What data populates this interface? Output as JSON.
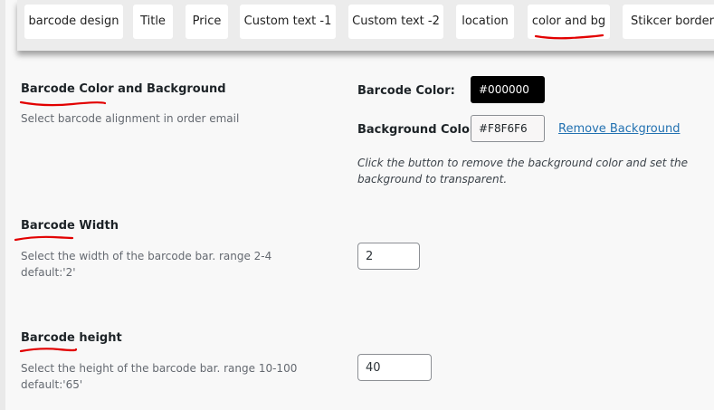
{
  "tabs": [
    {
      "label": "barcode design"
    },
    {
      "label": "Title"
    },
    {
      "label": "Price"
    },
    {
      "label": "Custom text -1"
    },
    {
      "label": "Custom text -2"
    },
    {
      "label": "location"
    },
    {
      "label": "color and bg"
    },
    {
      "label": "Stikcer border"
    }
  ],
  "color_section": {
    "title": "Barcode Color and Background",
    "description": "Select barcode alignment in order email",
    "barcode_color_label": "Barcode Color:",
    "barcode_color_value": "#000000",
    "background_color_label": "Background Color:",
    "background_color_value": "#F8F6F6",
    "remove_background_link": "Remove Background",
    "note": "Click the button to remove the background color and set the background to transparent."
  },
  "width_section": {
    "title": "Barcode Width",
    "description": "Select the width of the barcode bar. range 2-4 default:'2'",
    "value": "2"
  },
  "height_section": {
    "title": "Barcode height",
    "description": "Select the height of the barcode bar. range 10-100 default:'65'",
    "value": "40"
  },
  "colors": {
    "accent_link": "#2271b1",
    "annotation_red": "#e20000"
  }
}
